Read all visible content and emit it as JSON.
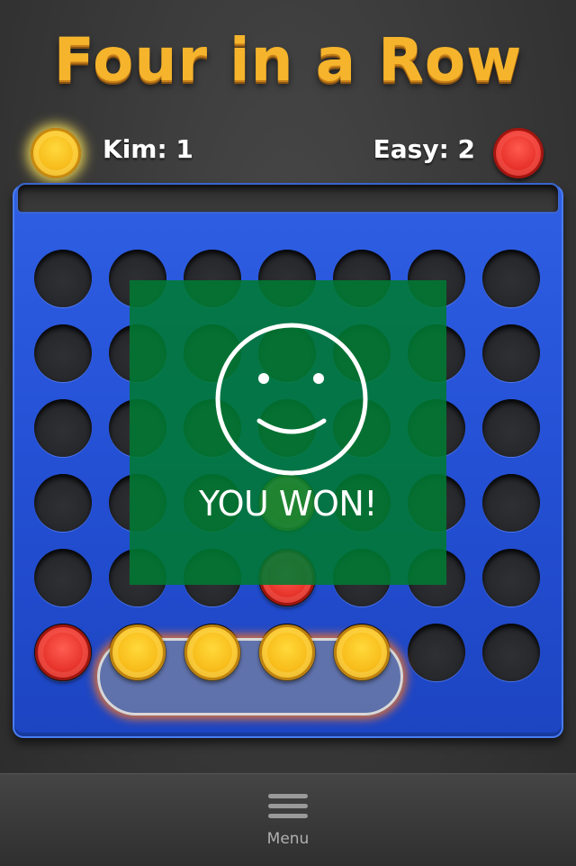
{
  "title": "Four in a Row",
  "players": {
    "left": {
      "label": "Kim: 1",
      "chip_color": "yellow"
    },
    "right": {
      "label": "Easy: 2",
      "chip_color": "red"
    }
  },
  "board": {
    "columns": 7,
    "rows": 6,
    "pieces": [
      {
        "row": 3,
        "col": 3,
        "color": "yellow"
      },
      {
        "row": 4,
        "col": 3,
        "color": "red"
      },
      {
        "row": 5,
        "col": 0,
        "color": "red"
      },
      {
        "row": 5,
        "col": 1,
        "color": "yellow"
      },
      {
        "row": 5,
        "col": 2,
        "color": "yellow"
      },
      {
        "row": 5,
        "col": 3,
        "color": "yellow"
      },
      {
        "row": 5,
        "col": 4,
        "color": "yellow"
      }
    ],
    "winning_row": 5
  },
  "result": {
    "message": "YOU WON!",
    "icon": "smiley-icon"
  },
  "menu": {
    "label": "Menu",
    "icon": "hamburger-menu-icon"
  },
  "colors": {
    "board": "#2450d4",
    "overlay": "#007a32",
    "red": "#e8352c",
    "yellow": "#f8bd1b",
    "title": "#f5b42c"
  }
}
